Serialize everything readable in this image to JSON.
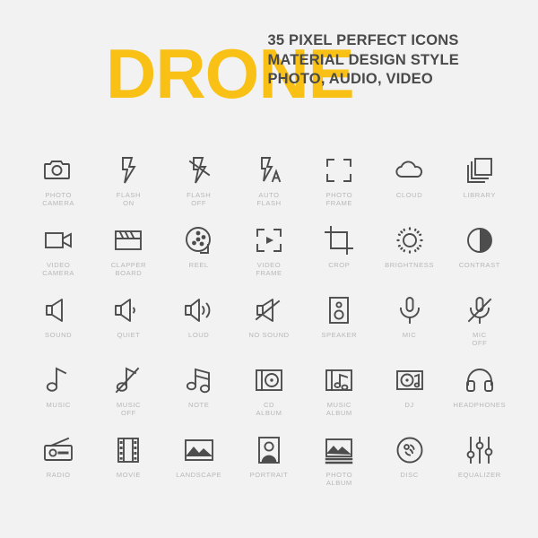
{
  "header": {
    "title": "DRONE",
    "subtitle_lines": [
      "35 PIXEL PERFECT ICONS",
      "MATERIAL DESIGN STYLE",
      "PHOTO, AUDIO, VIDEO"
    ],
    "accent_color": "#f9c116",
    "text_color": "#4a4a4a"
  },
  "colors": {
    "background": "#f2f2f2",
    "icon_stroke": "#4d4d4d",
    "label": "#b8b8b8"
  },
  "icons": [
    {
      "name": "photo-camera-icon",
      "label": "PHOTO\nCAMERA"
    },
    {
      "name": "flash-on-icon",
      "label": "FLASH\nON"
    },
    {
      "name": "flash-off-icon",
      "label": "FLASH\nOFF"
    },
    {
      "name": "auto-flash-icon",
      "label": "AUTO\nFLASH"
    },
    {
      "name": "photo-frame-icon",
      "label": "PHOTO\nFRAME"
    },
    {
      "name": "cloud-icon",
      "label": "CLOUD"
    },
    {
      "name": "library-icon",
      "label": "LIBRARY"
    },
    {
      "name": "video-camera-icon",
      "label": "VIDEO\nCAMERA"
    },
    {
      "name": "clapper-board-icon",
      "label": "CLAPPER\nBOARD"
    },
    {
      "name": "reel-icon",
      "label": "REEL"
    },
    {
      "name": "video-frame-icon",
      "label": "VIDEO\nFRAME"
    },
    {
      "name": "crop-icon",
      "label": "CROP"
    },
    {
      "name": "brightness-icon",
      "label": "BRIGHTNESS"
    },
    {
      "name": "contrast-icon",
      "label": "CONTRAST"
    },
    {
      "name": "sound-icon",
      "label": "SOUND"
    },
    {
      "name": "quiet-icon",
      "label": "QUIET"
    },
    {
      "name": "loud-icon",
      "label": "LOUD"
    },
    {
      "name": "no-sound-icon",
      "label": "NO SOUND"
    },
    {
      "name": "speaker-icon",
      "label": "SPEAKER"
    },
    {
      "name": "mic-icon",
      "label": "MIC"
    },
    {
      "name": "mic-off-icon",
      "label": "MIC\nOFF"
    },
    {
      "name": "music-icon",
      "label": "MUSIC"
    },
    {
      "name": "music-off-icon",
      "label": "MUSIC\nOFF"
    },
    {
      "name": "note-icon",
      "label": "NOTE"
    },
    {
      "name": "cd-album-icon",
      "label": "CD\nALBUM"
    },
    {
      "name": "music-album-icon",
      "label": "MUSIC\nALBUM"
    },
    {
      "name": "dj-icon",
      "label": "DJ"
    },
    {
      "name": "headphones-icon",
      "label": "HEADPHONES"
    },
    {
      "name": "radio-icon",
      "label": "RADIO"
    },
    {
      "name": "movie-icon",
      "label": "MOVIE"
    },
    {
      "name": "landscape-icon",
      "label": "LANDSCAPE"
    },
    {
      "name": "portrait-icon",
      "label": "PORTRAIT"
    },
    {
      "name": "photo-album-icon",
      "label": "PHOTO\nALBUM"
    },
    {
      "name": "disc-icon",
      "label": "DISC"
    },
    {
      "name": "equalizer-icon",
      "label": "EQUALIZER"
    }
  ]
}
